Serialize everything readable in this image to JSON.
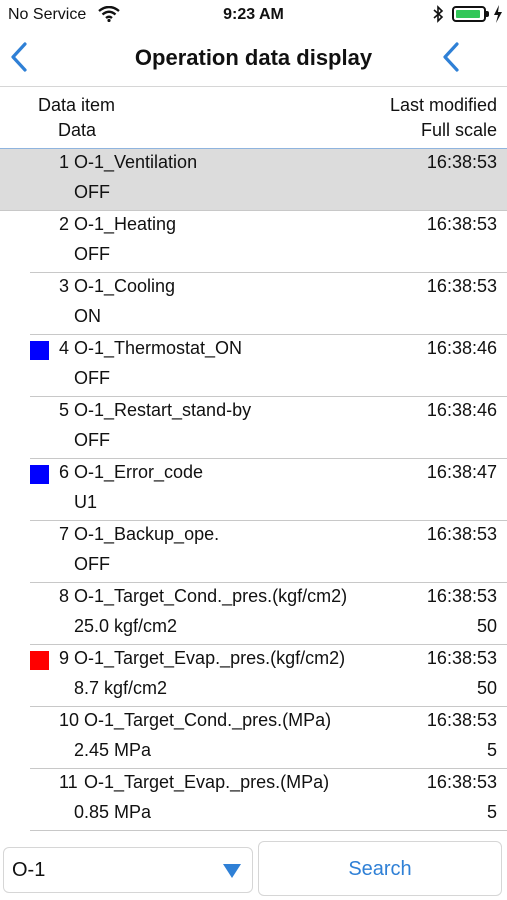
{
  "status": {
    "carrier": "No Service",
    "time": "9:23 AM"
  },
  "nav": {
    "title": "Operation data display"
  },
  "header": {
    "data_item": "Data item",
    "data": "Data",
    "last_modified": "Last modified",
    "full_scale": "Full scale"
  },
  "colors": {
    "accent": "#2f80d6",
    "marker_blue": "#0000ff",
    "marker_red": "#ff0000",
    "selected_row": "#dcdcdc"
  },
  "rows": [
    {
      "num": "1",
      "name": "O-1_Ventilation",
      "time": "16:38:53",
      "value": "OFF",
      "scale": "",
      "marker": "",
      "selected": true
    },
    {
      "num": "2",
      "name": "O-1_Heating",
      "time": "16:38:53",
      "value": "OFF",
      "scale": "",
      "marker": ""
    },
    {
      "num": "3",
      "name": "O-1_Cooling",
      "time": "16:38:53",
      "value": "ON",
      "scale": "",
      "marker": ""
    },
    {
      "num": "4",
      "name": "O-1_Thermostat_ON",
      "time": "16:38:46",
      "value": "OFF",
      "scale": "",
      "marker": "blue"
    },
    {
      "num": "5",
      "name": "O-1_Restart_stand-by",
      "time": "16:38:46",
      "value": "OFF",
      "scale": "",
      "marker": ""
    },
    {
      "num": "6",
      "name": "O-1_Error_code",
      "time": "16:38:47",
      "value": "U1",
      "scale": "",
      "marker": "blue"
    },
    {
      "num": "7",
      "name": "O-1_Backup_ope.",
      "time": "16:38:53",
      "value": "OFF",
      "scale": "",
      "marker": ""
    },
    {
      "num": "8",
      "name": "O-1_Target_Cond._pres.(kgf/cm2)",
      "time": "16:38:53",
      "value": "25.0 kgf/cm2",
      "scale": "50",
      "marker": ""
    },
    {
      "num": "9",
      "name": "O-1_Target_Evap._pres.(kgf/cm2)",
      "time": "16:38:53",
      "value": "8.7 kgf/cm2",
      "scale": "50",
      "marker": "red"
    },
    {
      "num": "10",
      "name": "O-1_Target_Cond._pres.(MPa)",
      "time": "16:38:53",
      "value": "2.45 MPa",
      "scale": "5",
      "marker": ""
    },
    {
      "num": "11",
      "name": "O-1_Target_Evap._pres.(MPa)",
      "time": "16:38:53",
      "value": "0.85 MPa",
      "scale": "5",
      "marker": ""
    }
  ],
  "bottom": {
    "selected_unit": "O-1",
    "search_label": "Search"
  }
}
